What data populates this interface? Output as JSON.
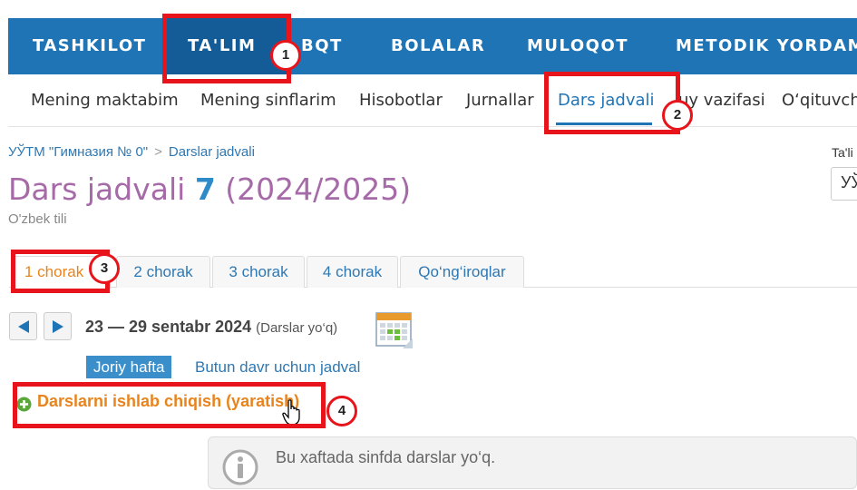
{
  "topnav": {
    "items": [
      "TASHKILOT",
      "TA'LIM",
      "BQT",
      "BOLALAR",
      "MULOQOT",
      "METODIK YORDAM"
    ],
    "active_index": 1,
    "color": "#1f74b5"
  },
  "subnav": {
    "items": [
      "Mening maktabim",
      "Mening sinflarim",
      "Hisobotlar",
      "Jurnallar",
      "Dars jadvali",
      "uy vazifasi",
      "O‘qituvch"
    ],
    "active_index": 4
  },
  "breadcrumb": {
    "root": "УЎТМ \"Гимназия № 0\"",
    "separator": ">",
    "current": "Darslar jadvali"
  },
  "right_panel": {
    "label": "Ta'li",
    "select_value": "УЎ"
  },
  "page": {
    "title_prefix": "Dars jadvali",
    "class_number": "7",
    "year": "(2024/2025)",
    "subtitle": "O'zbek tili"
  },
  "tabs": [
    "1 chorak",
    "2 chorak",
    "3 chorak",
    "4 chorak",
    "Qo‘ng‘iroqlar"
  ],
  "week": {
    "range": "23 — 29 sentabr 2024",
    "note": "(Darslar yo‘q)",
    "current_week_label": "Joriy hafta",
    "full_period_link": "Butun davr uchun jadval"
  },
  "create_link": "Darslarni ishlab chiqish (yaratish)",
  "info_message": "Bu xaftada sinfda darslar yo‘q.",
  "annotations": [
    "1",
    "2",
    "3",
    "4"
  ],
  "colors": {
    "accent": "#e8841e",
    "title": "#a56aa7",
    "link": "#2e78b3",
    "highlight": "#e8141b"
  }
}
